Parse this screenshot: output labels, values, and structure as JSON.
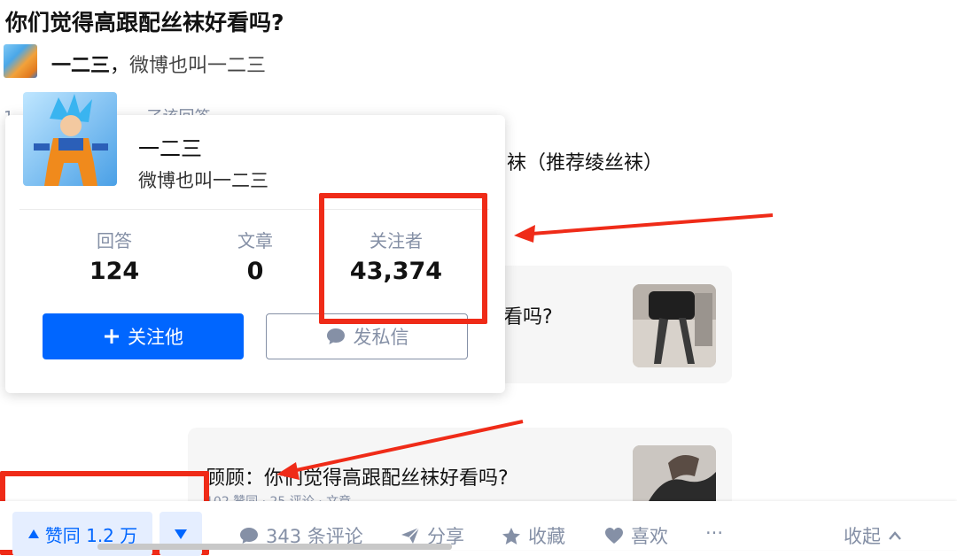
{
  "question": {
    "title": "你们觉得高跟配丝袜好看吗?"
  },
  "author": {
    "name": "一二三",
    "sep": "，",
    "bio": "微博也叫一二三"
  },
  "meta_line": "1",
  "meta_line_tail": "了该回答",
  "answer_excerpt": "袜（推荐绫丝袜）",
  "popup": {
    "name": "一二三",
    "bio": "微博也叫一二三",
    "stats": [
      {
        "label": "回答",
        "value": "124"
      },
      {
        "label": "文章",
        "value": "0"
      },
      {
        "label": "关注者",
        "value": "43,374"
      }
    ],
    "follow_label": "关注他",
    "message_label": "发私信"
  },
  "related": [
    {
      "text": "看吗?"
    },
    {
      "text": "顾顾：你们觉得高跟配丝袜好看吗?",
      "sub": "102 赞同 · 25 评论 · 文章"
    }
  ],
  "actions": {
    "upvote_label": "赞同 1.2 万",
    "comments_label": "343 条评论",
    "share_label": "分享",
    "collect_label": "收藏",
    "like_label": "喜欢",
    "more_label": "···",
    "collapse_label": "收起"
  },
  "colors": {
    "accent": "#0066ff",
    "annotation_red": "#ef2b18",
    "muted": "#8590a6"
  }
}
